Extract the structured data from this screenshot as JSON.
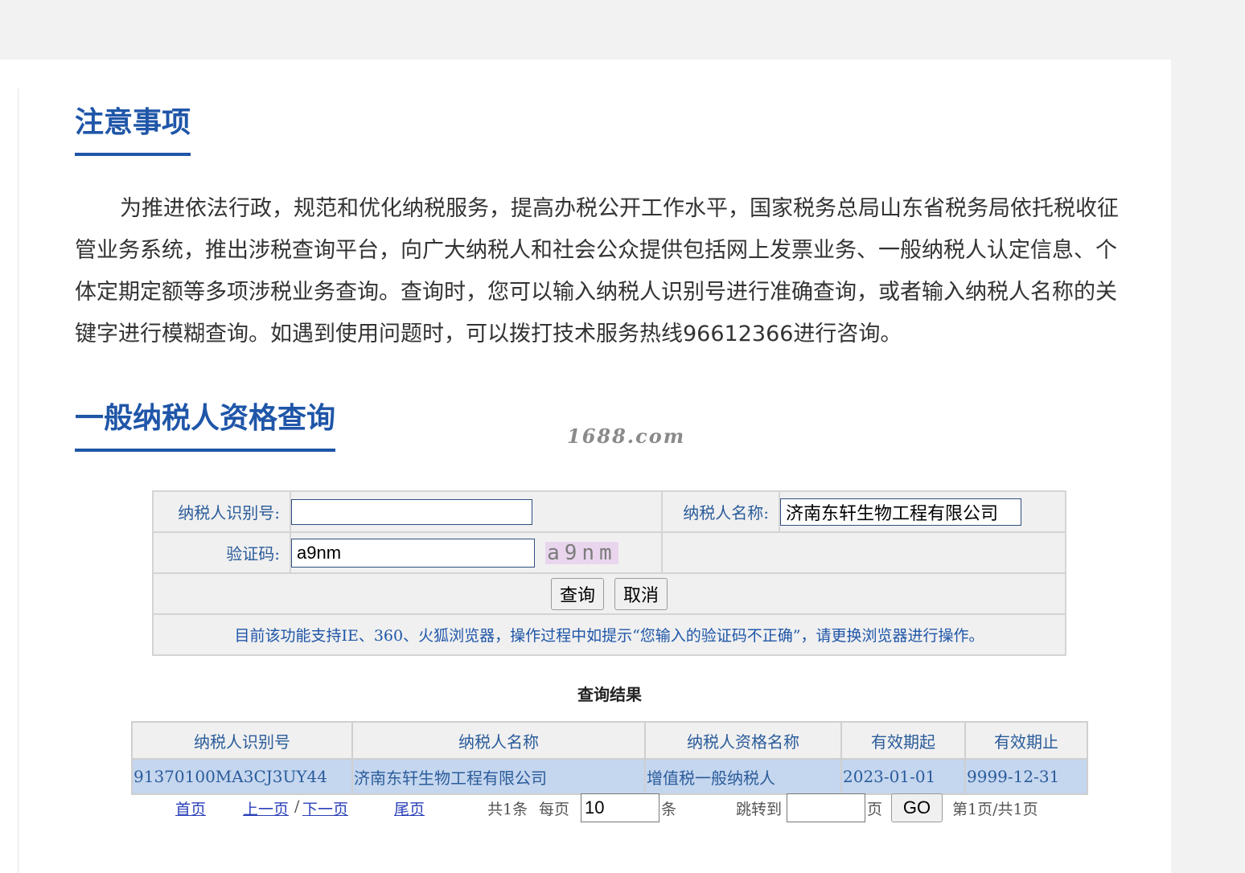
{
  "notice": {
    "heading": "注意事项",
    "paragraph": "为推进依法行政，规范和优化纳税服务，提高办税公开工作水平，国家税务总局山东省税务局依托税收征管业务系统，推出涉税查询平台，向广大纳税人和社会公众提供包括网上发票业务、一般纳税人认定信息、个体定期定额等多项涉税业务查询。查询时，您可以输入纳税人识别号进行准确查询，或者输入纳税人名称的关键字进行模糊查询。如遇到使用问题时，可以拨打技术服务热线96612366进行咨询。"
  },
  "query": {
    "heading": "一般纳税人资格查询",
    "watermark": "1688.com",
    "taxpayer_id_label": "纳税人识别号:",
    "taxpayer_id_value": "",
    "taxpayer_name_label": "纳税人名称:",
    "taxpayer_name_value": "济南东轩生物工程有限公司",
    "captcha_label": "验证码:",
    "captcha_value": "a9nm",
    "captcha_image_text": "a9nm",
    "search_button": "查询",
    "cancel_button": "取消",
    "tip": "目前该功能支持IE、360、火狐浏览器，操作过程中如提示“您输入的验证码不正确”，请更换浏览器进行操作。"
  },
  "results": {
    "title": "查询结果",
    "columns": [
      "纳税人识别号",
      "纳税人名称",
      "纳税人资格名称",
      "有效期起",
      "有效期止"
    ],
    "rows": [
      [
        "91370100MA3CJ3UY44",
        "济南东轩生物工程有限公司",
        "增值税一般纳税人",
        "2023-01-01",
        "9999-12-31"
      ]
    ]
  },
  "pager": {
    "first": "首页",
    "prev": "上一页",
    "separator": "/",
    "next": "下一页",
    "last": "尾页",
    "total": "共1条",
    "per_page_label": "每页",
    "per_page_value": "10",
    "per_page_unit": "条",
    "jump_label": "跳转到",
    "jump_value": "",
    "page_unit": "页",
    "go_button": "GO",
    "page_status": "第1页/共1页"
  },
  "colors": {
    "heading": "#1f56a8",
    "row_highlight": "#c5d6ef",
    "label": "#2a5c9a"
  }
}
